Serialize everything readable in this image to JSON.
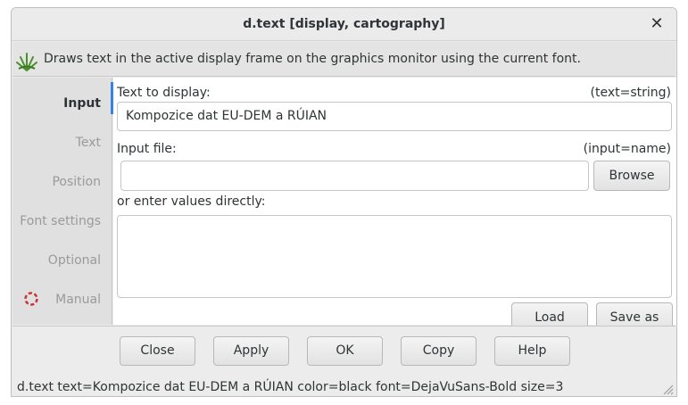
{
  "window": {
    "title": "d.text [display, cartography]",
    "close_glyph": "✕"
  },
  "description": "Draws text in the active display frame on the graphics monitor using the current font.",
  "tabs": [
    {
      "label": "Input",
      "active": true
    },
    {
      "label": "Text",
      "active": false
    },
    {
      "label": "Position",
      "active": false
    },
    {
      "label": "Font settings",
      "active": false
    },
    {
      "label": "Optional",
      "active": false
    },
    {
      "label": "Manual",
      "active": false,
      "icon": "lifebuoy-icon"
    }
  ],
  "input": {
    "text_label": "Text to display:",
    "text_key": "(text=string)",
    "text_value": "Kompozice dat EU-DEM a RÚIAN",
    "file_label": "Input file:",
    "file_key": "(input=name)",
    "file_value": "",
    "browse_label": "Browse",
    "direct_label": "or enter values directly:",
    "direct_value": "",
    "load_label": "Load",
    "saveas_label": "Save as"
  },
  "buttons": {
    "close": "Close",
    "apply": "Apply",
    "ok": "OK",
    "copy": "Copy",
    "help": "Help"
  },
  "status": "d.text text=Kompozice dat EU-DEM a RÚIAN color=black font=DejaVuSans-Bold size=3",
  "colors": {
    "accent": "#3584e4",
    "grass_green": "#4a8f2c",
    "lifebuoy_red": "#cc3333"
  }
}
